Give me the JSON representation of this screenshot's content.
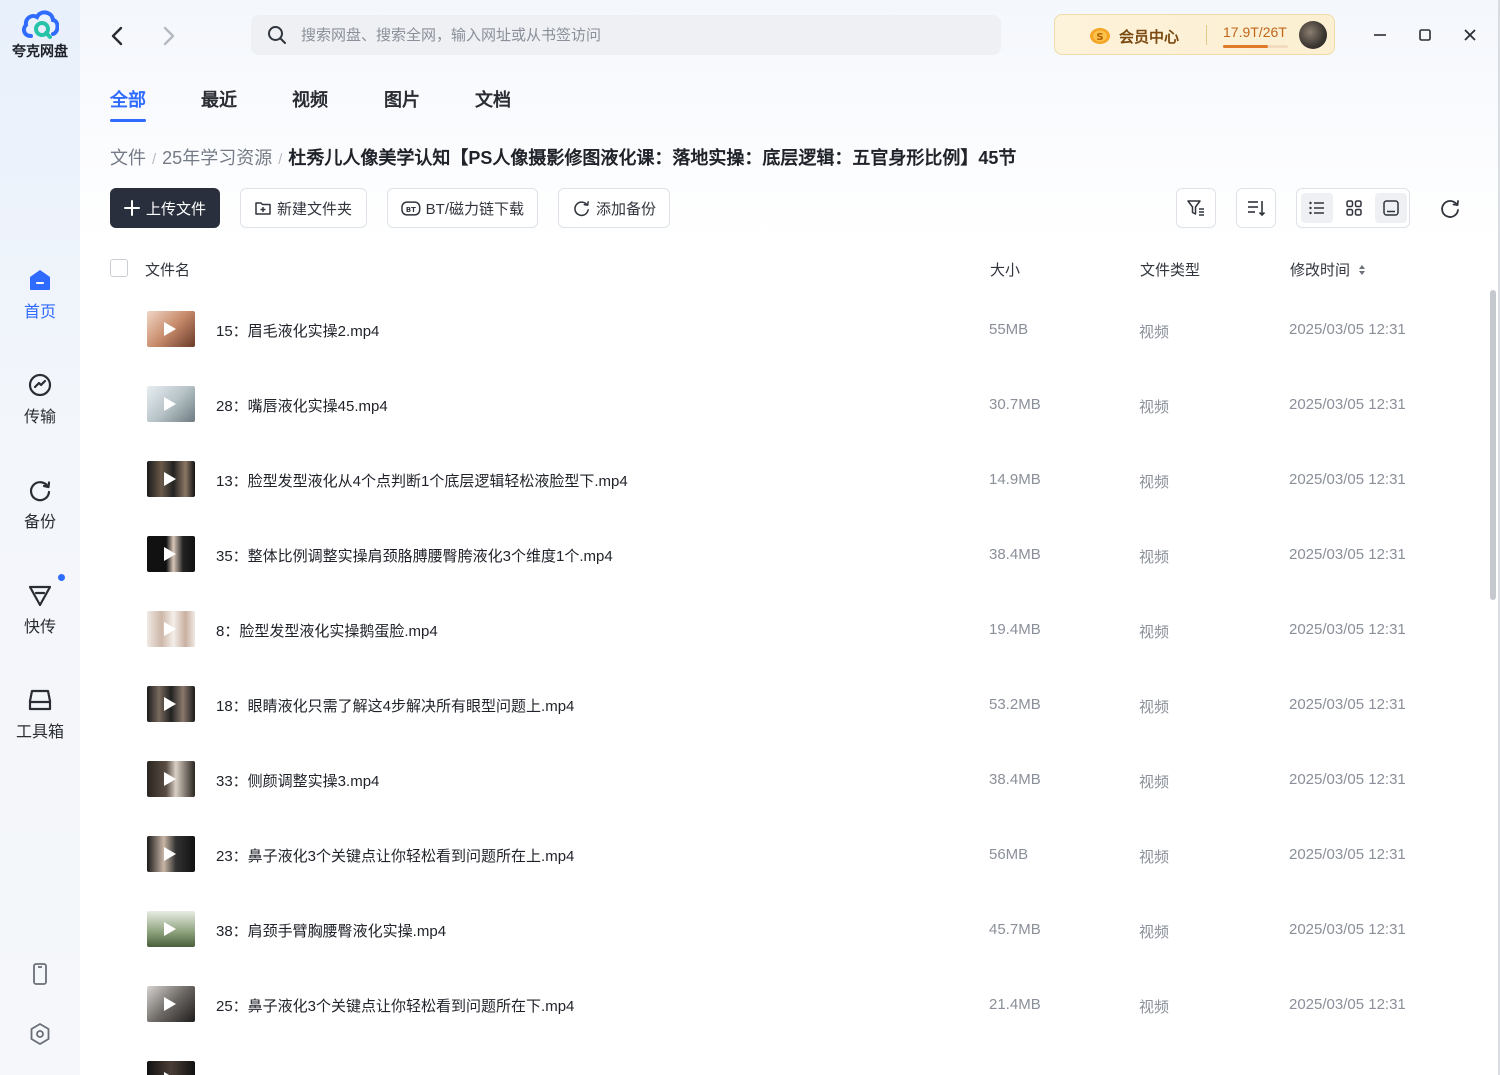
{
  "app": {
    "name": "夸克网盘"
  },
  "sidebar": {
    "items": [
      {
        "label": "首页",
        "icon": "home-icon"
      },
      {
        "label": "传输",
        "icon": "transfer-icon"
      },
      {
        "label": "备份",
        "icon": "backup-icon"
      },
      {
        "label": "快传",
        "icon": "quick-send-icon"
      },
      {
        "label": "工具箱",
        "icon": "toolbox-icon"
      }
    ],
    "bottom": [
      {
        "icon": "phone-icon"
      },
      {
        "icon": "settings-icon"
      }
    ]
  },
  "search": {
    "placeholder": "搜索网盘、搜索全网，输入网址或从书签访问"
  },
  "vip": {
    "label": "会员中心",
    "storage": "17.9T/26T",
    "used_fraction": 0.69
  },
  "tabs": [
    {
      "label": "全部"
    },
    {
      "label": "最近"
    },
    {
      "label": "视频"
    },
    {
      "label": "图片"
    },
    {
      "label": "文档"
    }
  ],
  "breadcrumb": {
    "root": "文件",
    "parent": "25年学习资源",
    "current": "杜秀儿人像美学认知【PS人像摄影修图液化课：落地实操：底层逻辑：五官身形比例】45节"
  },
  "toolbar": {
    "upload": "上传文件",
    "new_folder": "新建文件夹",
    "bt_download": "BT/磁力链下载",
    "add_backup": "添加备份"
  },
  "table": {
    "headers": {
      "name": "文件名",
      "size": "大小",
      "type": "文件类型",
      "modified": "修改时间"
    },
    "rows": [
      {
        "name": "15：眉毛液化实操2.mp4",
        "size": "55MB",
        "type": "视频",
        "modified": "2025/03/05 12:31"
      },
      {
        "name": "28：嘴唇液化实操45.mp4",
        "size": "30.7MB",
        "type": "视频",
        "modified": "2025/03/05 12:31"
      },
      {
        "name": "13：脸型发型液化从4个点判断1个底层逻辑轻松液脸型下.mp4",
        "size": "14.9MB",
        "type": "视频",
        "modified": "2025/03/05 12:31"
      },
      {
        "name": "35：整体比例调整实操肩颈胳膊腰臀胯液化3个维度1个.mp4",
        "size": "38.4MB",
        "type": "视频",
        "modified": "2025/03/05 12:31"
      },
      {
        "name": "8：脸型发型液化实操鹅蛋脸.mp4",
        "size": "19.4MB",
        "type": "视频",
        "modified": "2025/03/05 12:31"
      },
      {
        "name": "18：眼睛液化只需了解这4步解决所有眼型问题上.mp4",
        "size": "53.2MB",
        "type": "视频",
        "modified": "2025/03/05 12:31"
      },
      {
        "name": "33：侧颜调整实操3.mp4",
        "size": "38.4MB",
        "type": "视频",
        "modified": "2025/03/05 12:31"
      },
      {
        "name": "23：鼻子液化3个关键点让你轻松看到问题所在上.mp4",
        "size": "56MB",
        "type": "视频",
        "modified": "2025/03/05 12:31"
      },
      {
        "name": "38：肩颈手臂胸腰臀液化实操.mp4",
        "size": "45.7MB",
        "type": "视频",
        "modified": "2025/03/05 12:31"
      },
      {
        "name": "25：鼻子液化3个关键点让你轻松看到问题所在下.mp4",
        "size": "21.4MB",
        "type": "视频",
        "modified": "2025/03/05 12:31"
      },
      {
        "name": "",
        "size": "",
        "type": "",
        "modified": ""
      }
    ]
  },
  "colors": {
    "accent": "#2f6bff",
    "primary_button": "#2a2f3d",
    "vip_text": "#7a4a12"
  }
}
